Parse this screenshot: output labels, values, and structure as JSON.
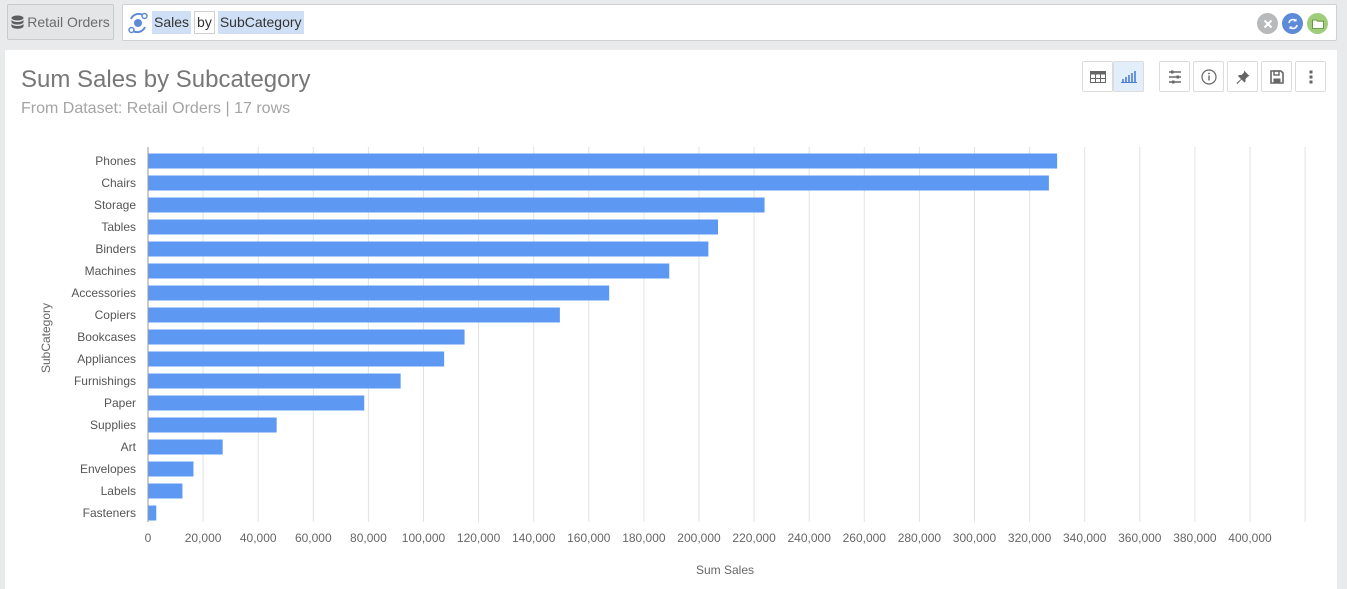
{
  "topbar": {
    "dataset_button_label": "Retail Orders",
    "query_tokens": [
      {
        "text": "Sales",
        "kind": "field"
      },
      {
        "text": "by",
        "kind": "keyword"
      },
      {
        "text": "SubCategory",
        "kind": "field"
      }
    ],
    "actions": [
      {
        "name": "clear",
        "icon": "close-icon",
        "color": "#b8b9bb"
      },
      {
        "name": "refresh",
        "icon": "refresh-icon",
        "color": "#5d8bd8"
      },
      {
        "name": "open",
        "icon": "folder-icon",
        "color": "#9fcd7a"
      }
    ]
  },
  "panel": {
    "title": "Sum Sales by Subcategory",
    "subtitle": "From Dataset: Retail Orders | 17 rows",
    "view_toggle": [
      {
        "name": "table-view",
        "icon": "table-icon",
        "active": false
      },
      {
        "name": "chart-view",
        "icon": "bar-chart-icon",
        "active": true
      }
    ],
    "tools": [
      {
        "name": "fields",
        "icon": "list-settings-icon"
      },
      {
        "name": "info",
        "icon": "info-icon"
      },
      {
        "name": "pin",
        "icon": "pin-icon"
      },
      {
        "name": "save",
        "icon": "save-icon"
      },
      {
        "name": "more",
        "icon": "more-vertical-icon"
      }
    ]
  },
  "chart_data": {
    "type": "bar",
    "orientation": "horizontal",
    "title": "",
    "xlabel": "Sum Sales",
    "ylabel": "SubCategory",
    "xlim": [
      0,
      420000
    ],
    "grid": true,
    "legend": "none",
    "bar_color": "#5d98f3",
    "x_ticks": [
      0,
      20000,
      40000,
      60000,
      80000,
      100000,
      120000,
      140000,
      160000,
      180000,
      200000,
      220000,
      240000,
      260000,
      280000,
      300000,
      320000,
      340000,
      360000,
      380000,
      400000
    ],
    "x_tick_labels": [
      "0",
      "20,000",
      "40,000",
      "60,000",
      "80,000",
      "100,000",
      "120,000",
      "140,000",
      "160,000",
      "180,000",
      "200,000",
      "220,000",
      "240,000",
      "260,000",
      "280,000",
      "300,000",
      "320,000",
      "340,000",
      "360,000",
      "380,000",
      "400,000"
    ],
    "categories": [
      "Phones",
      "Chairs",
      "Storage",
      "Tables",
      "Binders",
      "Machines",
      "Accessories",
      "Copiers",
      "Bookcases",
      "Appliances",
      "Furnishings",
      "Paper",
      "Supplies",
      "Art",
      "Envelopes",
      "Labels",
      "Fasteners"
    ],
    "values": [
      330000,
      327000,
      223800,
      206900,
      203400,
      189200,
      167400,
      149500,
      114900,
      107500,
      91700,
      78500,
      46700,
      27100,
      16500,
      12500,
      3000
    ]
  }
}
